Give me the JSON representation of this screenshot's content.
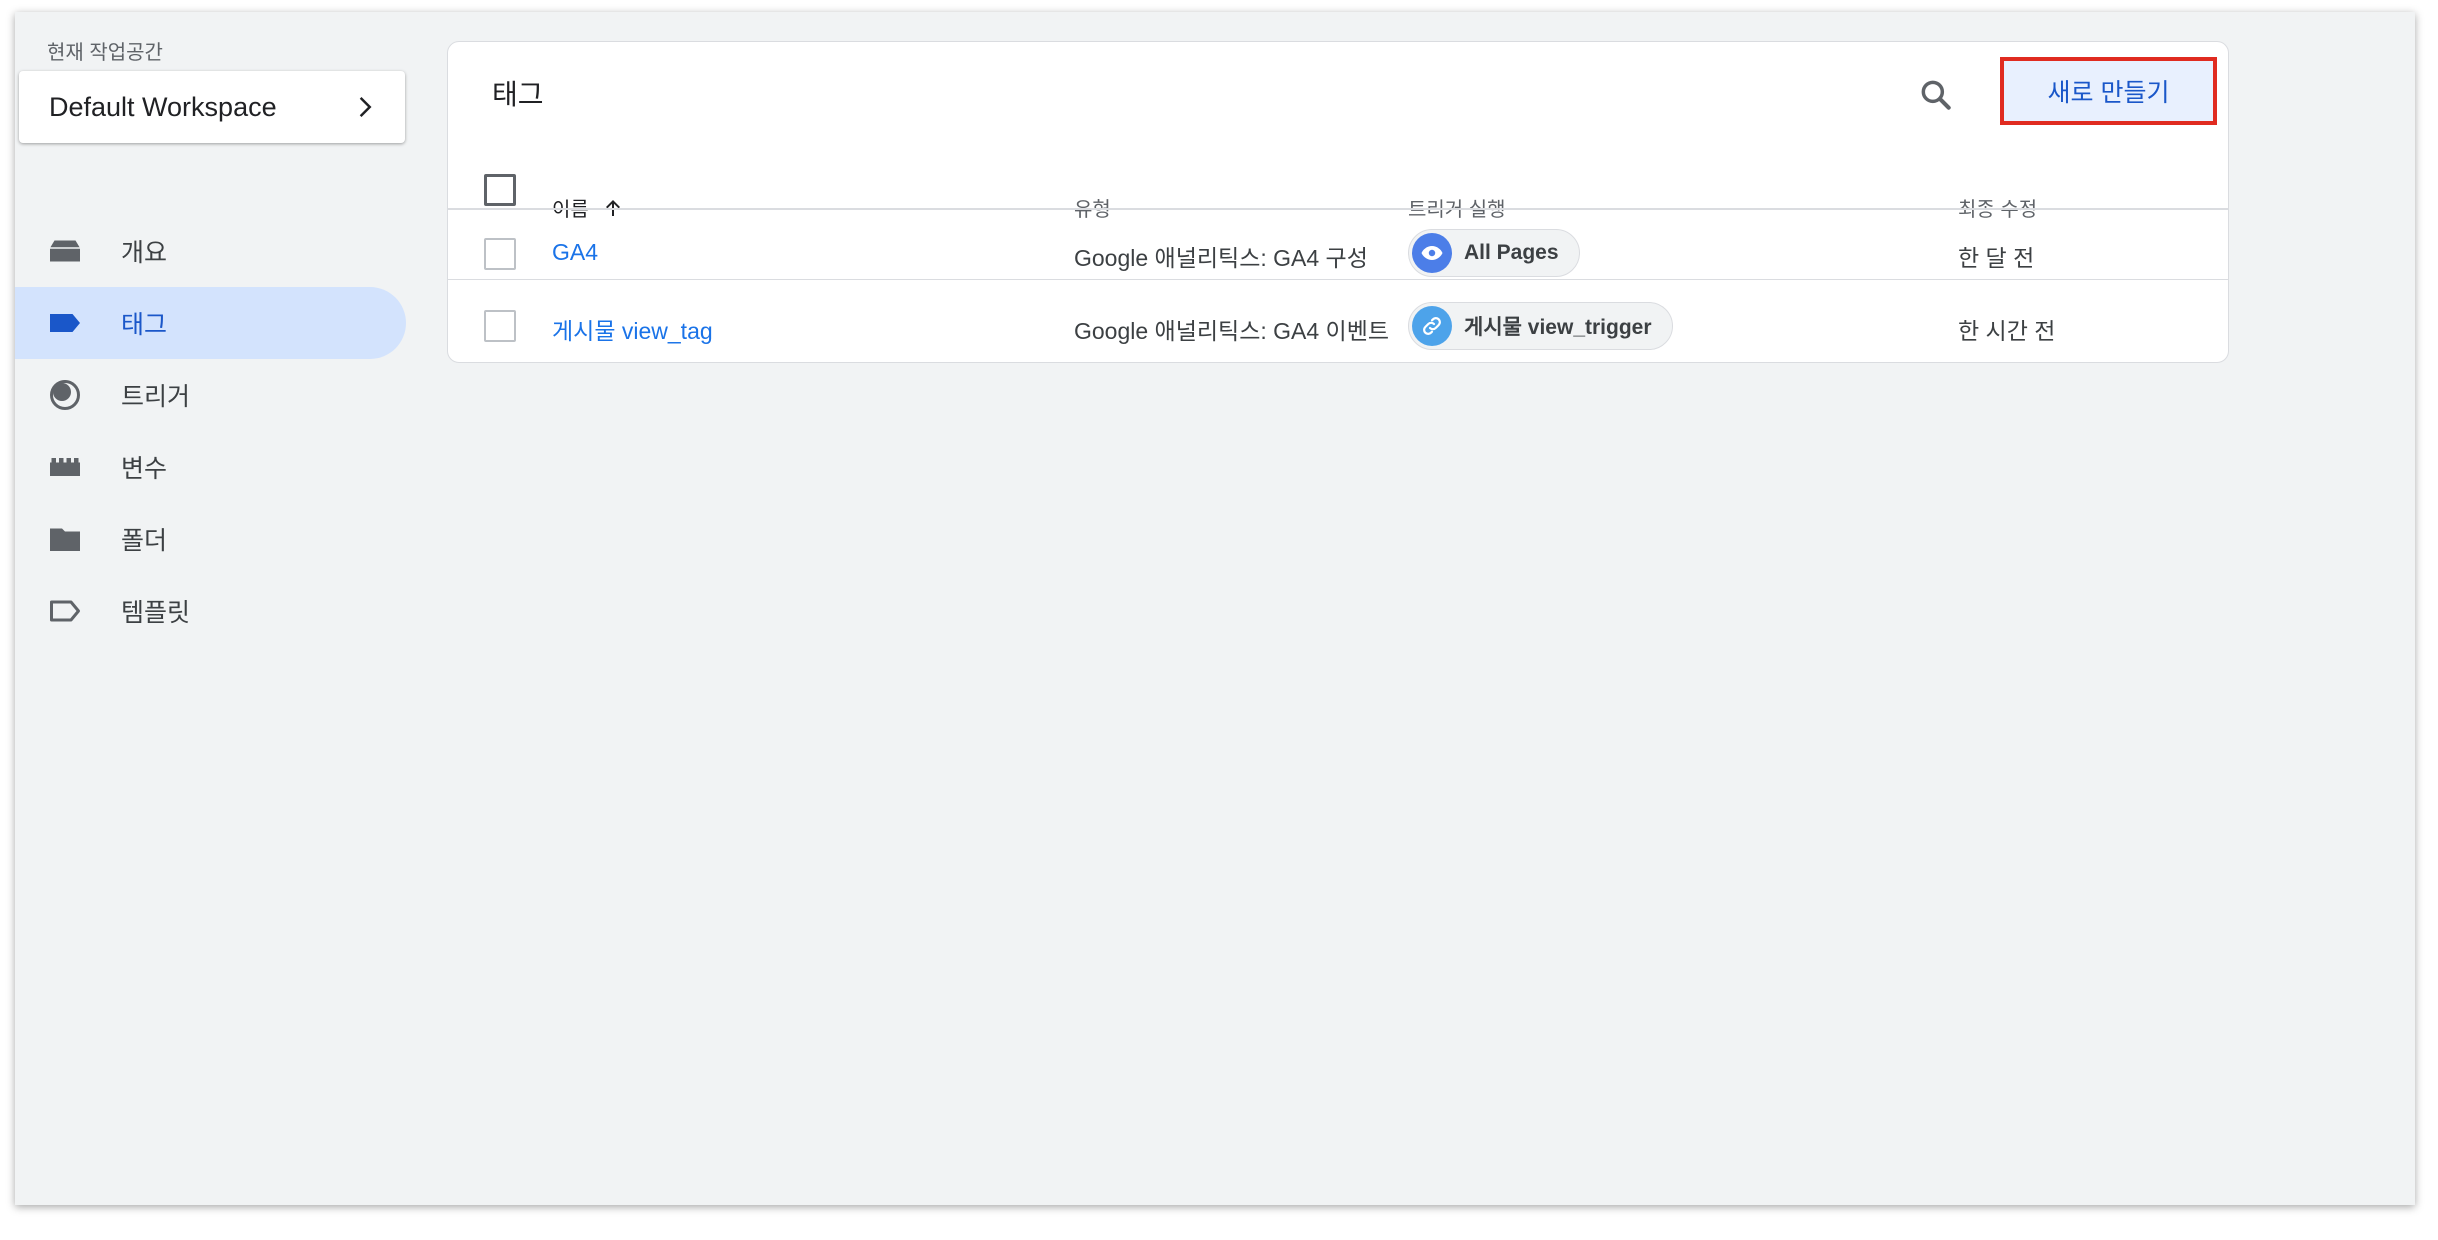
{
  "workspace": {
    "label": "현재 작업공간",
    "name": "Default Workspace"
  },
  "sidebar": {
    "items": [
      {
        "label": "개요",
        "icon": "overview-icon",
        "active": false
      },
      {
        "label": "태그",
        "icon": "tag-icon",
        "active": true
      },
      {
        "label": "트리거",
        "icon": "trigger-icon",
        "active": false
      },
      {
        "label": "변수",
        "icon": "variable-icon",
        "active": false
      },
      {
        "label": "폴더",
        "icon": "folder-icon",
        "active": false
      },
      {
        "label": "템플릿",
        "icon": "template-icon",
        "active": false
      }
    ]
  },
  "main": {
    "title": "태그",
    "new_button": "새로 만들기",
    "columns": {
      "name": "이름",
      "type": "유형",
      "trigger": "트리거 실행",
      "modified": "최종 수정"
    },
    "rows": [
      {
        "name": "GA4",
        "type": "Google 애널리틱스: GA4 구성",
        "trigger": "All Pages",
        "trigger_icon": "eye-icon",
        "trigger_color": "#4c7ee8",
        "modified": "한 달 전"
      },
      {
        "name": "게시물 view_tag",
        "type": "Google 애널리틱스: GA4 이벤트",
        "trigger": "게시물 view_trigger",
        "trigger_icon": "link-icon",
        "trigger_color": "#4da3ea",
        "modified": "한 시간 전"
      }
    ]
  },
  "colors": {
    "accent": "#1a73e8",
    "active_nav_bg": "#d3e3fd",
    "highlight_border": "#e02b20"
  }
}
